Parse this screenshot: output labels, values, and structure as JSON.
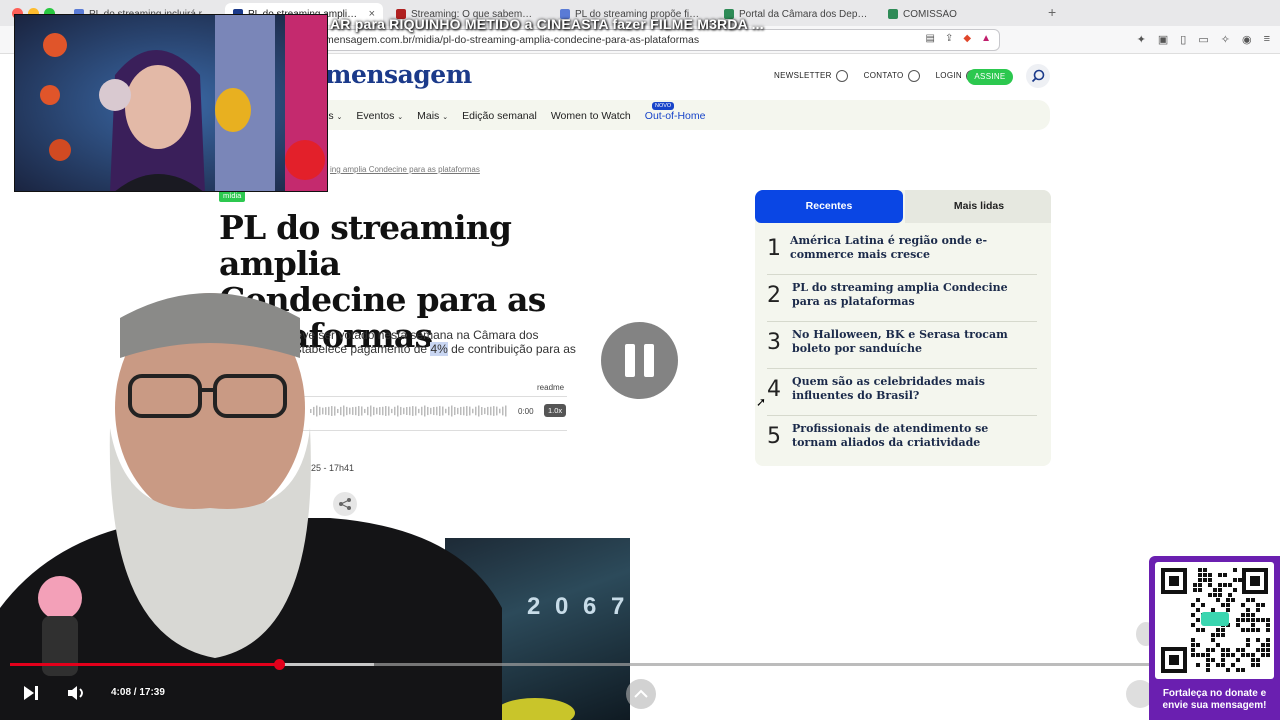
{
  "browser": {
    "tabs": [
      {
        "title": "PL do streaming incluirá remuner...",
        "color": "#5a7bd6"
      },
      {
        "title": "PL do streaming amplia Conde",
        "color": "#1b3a8a",
        "active": true
      },
      {
        "title": "Streaming: O que sabemos sobre",
        "color": "#b02020"
      },
      {
        "title": "PL do streaming propõe fim de re",
        "color": "#5a7bd6"
      },
      {
        "title": "Portal da Câmara dos Deputados",
        "color": "#2e8b57"
      },
      {
        "title": "COMISSÃO",
        "color": "#2e8b57"
      }
    ],
    "close_label": "×",
    "new_tab_label": "+",
    "url": "mensagem.com.br/midia/pl-do-streaming-amplia-condecine-para-as-plataformas"
  },
  "stream_overlay": {
    "title": "AR para RIQUINHO METIDO a CINEASTA fazer FILME M3RDA ..."
  },
  "site": {
    "logo": "mensagem",
    "top_links": {
      "newsletter": "NEWSLETTER",
      "contato": "CONTATO",
      "login": "LOGIN"
    },
    "assine": "ASSINE",
    "brand_color": "#1b3a8a",
    "accent_green": "#2cc84f",
    "nav": {
      "items": [
        {
          "label": "is",
          "has_menu": true
        },
        {
          "label": "Eventos",
          "has_menu": true
        },
        {
          "label": "Mais",
          "has_menu": true
        },
        {
          "label": "Edição semanal",
          "has_menu": false
        },
        {
          "label": "Women to Watch",
          "has_menu": false
        },
        {
          "label": "Out-of-Home",
          "has_menu": false,
          "highlight": true
        }
      ],
      "novo_badge": "NOVO"
    }
  },
  "article": {
    "breadcrumb": "ing amplia Condecine para as plataformas",
    "category": "mídia",
    "headline_lines": [
      "PL do streaming amplia",
      "Condecine para as",
      "plataformas"
    ],
    "lede_line1": "deve ser votado nesta semana na Câmara dos",
    "lede_line2_pre": "estabelece pagamento de ",
    "lede_highlight": "4%",
    "lede_line2_post": " de contribuição para as",
    "readme": "readme",
    "audio_time": "0:00",
    "audio_speed": "1.0x",
    "date": "25 - 17h41",
    "image_text": "2 0 6 7"
  },
  "sidebar": {
    "tabs": {
      "recentes": "Recentes",
      "mais_lidas": "Mais lidas"
    },
    "active_color": "#0a46e4",
    "items": [
      {
        "num": "1",
        "title": "América Latina é região onde e-commerce mais cresce"
      },
      {
        "num": "2",
        "title": "PL do streaming amplia Condecine para as plataformas"
      },
      {
        "num": "3",
        "title": "No Halloween, BK e Serasa trocam boleto por sanduíche"
      },
      {
        "num": "4",
        "title": "Quem são as celebridades mais influentes do Brasil?"
      },
      {
        "num": "5",
        "title": "Profissionais de atendimento se tornam aliados da criatividade"
      }
    ]
  },
  "player": {
    "time": "4:08 / 17:39",
    "progress_fraction": 0.236,
    "progress_color": "#e3001b"
  },
  "donate": {
    "caption_line1": "Fortaleça no donate e",
    "caption_line2": "envie sua mensagem!",
    "color": "#6a1fb0"
  }
}
